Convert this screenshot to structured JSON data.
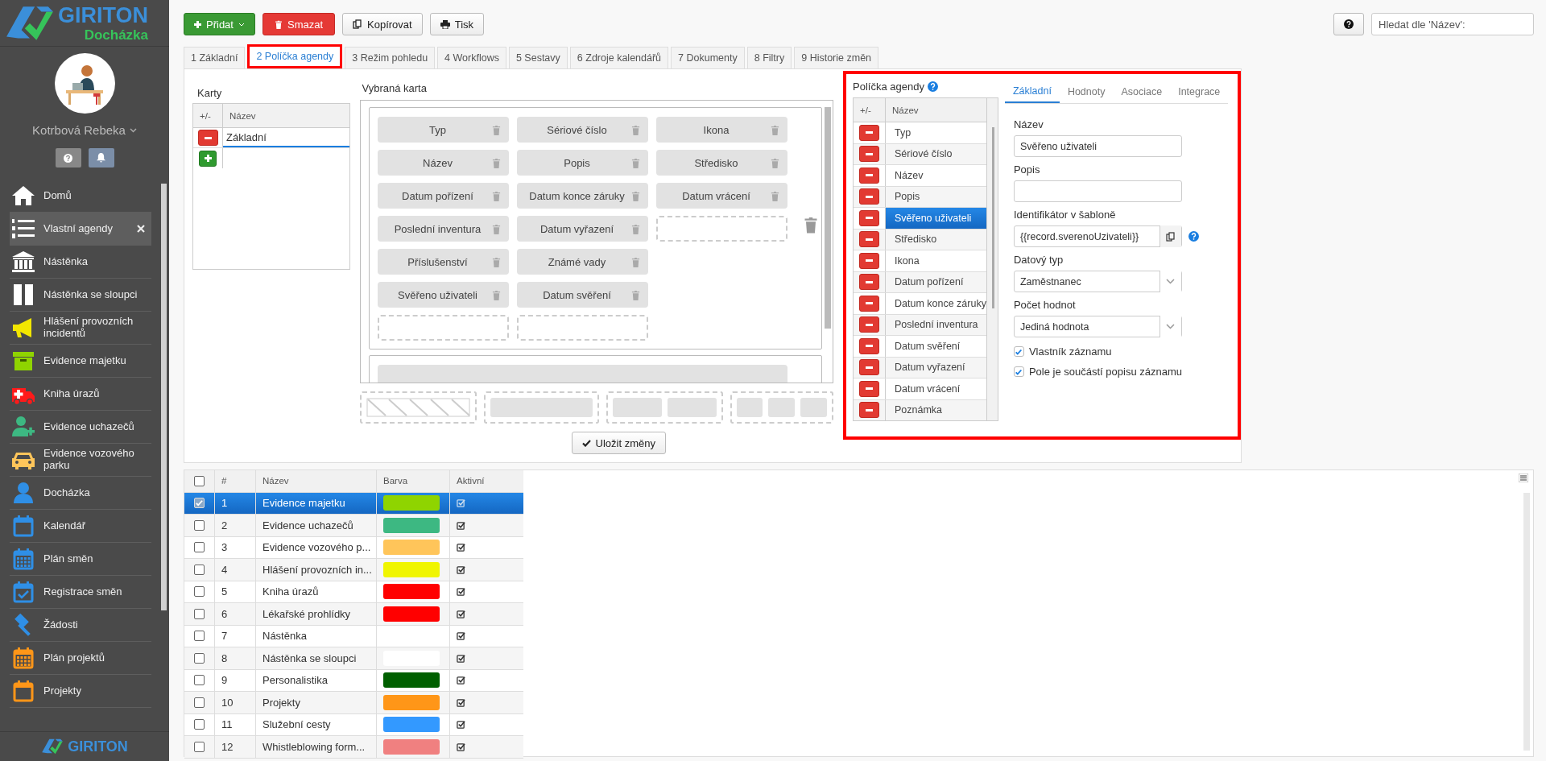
{
  "sidebar": {
    "logo": {
      "title": "GIRITON",
      "subtitle": "Docházka"
    },
    "user": {
      "name": "Kotrbová Rebeka"
    },
    "items": [
      {
        "label": "Domů",
        "kind": "home",
        "color": "#ffffff",
        "selected": false
      },
      {
        "label": "Vlastní agendy",
        "kind": "list",
        "color": "#ffffff",
        "selected": true
      },
      {
        "label": "Nástěnka",
        "kind": "bank",
        "color": "#ffffff",
        "selected": false
      },
      {
        "label": "Nástěnka se sloupci",
        "kind": "columns",
        "color": "#ffffff",
        "selected": false
      },
      {
        "label": "Hlášení provozních incidentů",
        "kind": "megaphone",
        "color": "#f2e600",
        "selected": false
      },
      {
        "label": "Evidence majetku",
        "kind": "box",
        "color": "#8fd400",
        "selected": false
      },
      {
        "label": "Kniha úrazů",
        "kind": "ambulance",
        "color": "#ff1a1a",
        "selected": false
      },
      {
        "label": "Evidence uchazečů",
        "kind": "user-plus",
        "color": "#3db882",
        "selected": false
      },
      {
        "label": "Evidence vozového parku",
        "kind": "car",
        "color": "#ffc55a",
        "selected": false
      },
      {
        "label": "Docházka",
        "kind": "user",
        "color": "#2f8fe6",
        "selected": false
      },
      {
        "label": "Kalendář",
        "kind": "calendar",
        "color": "#2f8fe6",
        "selected": false
      },
      {
        "label": "Plán směn",
        "kind": "calendar-grid",
        "color": "#2f8fe6",
        "selected": false
      },
      {
        "label": "Registrace směn",
        "kind": "calendar-check",
        "color": "#2f8fe6",
        "selected": false
      },
      {
        "label": "Žádosti",
        "kind": "gavel",
        "color": "#2f8fe6",
        "selected": false
      },
      {
        "label": "Plán projektů",
        "kind": "calendar-grid",
        "color": "#ff9618",
        "selected": false
      },
      {
        "label": "Projekty",
        "kind": "calendar",
        "color": "#ff9618",
        "selected": false
      }
    ],
    "footer_logo": "GIRITON"
  },
  "toolbar": {
    "buttons": [
      {
        "label": "Přidat",
        "kind": "add"
      },
      {
        "label": "Smazat",
        "kind": "delete"
      },
      {
        "label": "Kopírovat",
        "kind": "copy"
      },
      {
        "label": "Tisk",
        "kind": "print"
      }
    ],
    "search": {
      "placeholder": "Hledat dle 'Název':"
    }
  },
  "tabs": [
    {
      "label": "1 Základní",
      "selected": false,
      "highlighted": false
    },
    {
      "label": "2 Políčka agendy",
      "selected": true,
      "highlighted": true
    },
    {
      "label": "3 Režim pohledu",
      "selected": false,
      "highlighted": false
    },
    {
      "label": "4 Workflows",
      "selected": false,
      "highlighted": false
    },
    {
      "label": "5 Sestavy",
      "selected": false,
      "highlighted": false
    },
    {
      "label": "6 Zdroje kalendářů",
      "selected": false,
      "highlighted": false
    },
    {
      "label": "7 Dokumenty",
      "selected": false,
      "highlighted": false
    },
    {
      "label": "8 Filtry",
      "selected": false,
      "highlighted": false
    },
    {
      "label": "9 Historie změn",
      "selected": false,
      "highlighted": false
    }
  ],
  "cards_panel": {
    "title": "Karty",
    "columns": [
      "+/-",
      "Název"
    ],
    "rows": [
      {
        "name": "Základní",
        "selected": true
      }
    ]
  },
  "selected_card": {
    "title": "Vybraná karta",
    "cards": [
      {
        "rows": [
          [
            {
              "kind": "field",
              "label": "Typ"
            },
            {
              "kind": "field",
              "label": "Sériové číslo"
            },
            {
              "kind": "field",
              "label": "Ikona"
            }
          ],
          [
            {
              "kind": "field",
              "label": "Název"
            },
            {
              "kind": "field",
              "label": "Popis"
            },
            {
              "kind": "field",
              "label": "Středisko"
            }
          ],
          [
            {
              "kind": "field",
              "label": "Datum pořízení"
            },
            {
              "kind": "field",
              "label": "Datum konce záruky"
            },
            {
              "kind": "field",
              "label": "Datum vrácení"
            }
          ],
          [
            {
              "kind": "field",
              "label": "Poslední inventura"
            },
            {
              "kind": "field",
              "label": "Datum vyřazení"
            },
            {
              "kind": "slot"
            }
          ],
          [
            {
              "kind": "field",
              "label": "Příslušenství"
            },
            {
              "kind": "field",
              "label": "Známé vady"
            }
          ],
          [
            {
              "kind": "field",
              "label": "Svěřeno uživateli"
            },
            {
              "kind": "field",
              "label": "Datum svěření"
            }
          ],
          [
            {
              "kind": "slot"
            },
            {
              "kind": "slot"
            }
          ]
        ]
      },
      {
        "rows": [
          [
            {
              "kind": "wide"
            }
          ]
        ]
      }
    ],
    "layouts": [
      {
        "kind": "hatched"
      },
      {
        "kind": "one"
      },
      {
        "kind": "two"
      },
      {
        "kind": "three"
      }
    ],
    "save_button": "Uložit změny"
  },
  "agenda_fields": {
    "title": "Políčka agendy",
    "highlighted": true,
    "columns": [
      "+/-",
      "Název"
    ],
    "rows": [
      {
        "name": "Typ",
        "selected": false
      },
      {
        "name": "Sériové číslo",
        "selected": false
      },
      {
        "name": "Název",
        "selected": false
      },
      {
        "name": "Popis",
        "selected": false
      },
      {
        "name": "Svěřeno uživateli",
        "selected": true
      },
      {
        "name": "Středisko",
        "selected": false
      },
      {
        "name": "Ikona",
        "selected": false
      },
      {
        "name": "Datum pořízení",
        "selected": false
      },
      {
        "name": "Datum konce záruky",
        "selected": false
      },
      {
        "name": "Poslední inventura",
        "selected": false
      },
      {
        "name": "Datum svěření",
        "selected": false
      },
      {
        "name": "Datum vyřazení",
        "selected": false
      },
      {
        "name": "Datum vrácení",
        "selected": false
      },
      {
        "name": "Poznámka",
        "selected": false
      }
    ],
    "tabs": [
      {
        "label": "Základní",
        "selected": true
      },
      {
        "label": "Hodnoty",
        "selected": false
      },
      {
        "label": "Asociace",
        "selected": false
      },
      {
        "label": "Integrace",
        "selected": false
      }
    ],
    "form": [
      {
        "label": "Název",
        "kind": "text",
        "value": "Svěřeno uživateli"
      },
      {
        "label": "Popis",
        "kind": "text"
      },
      {
        "label": "Identifikátor v šabloně",
        "kind": "copy",
        "value": "{{record.sverenoUzivateli}}"
      },
      {
        "label": "Datový typ",
        "kind": "select",
        "value": "Zaměstnanec"
      },
      {
        "label": "Počet hodnot",
        "kind": "select",
        "value": "Jediná hodnota"
      }
    ],
    "checks": [
      {
        "label": "Vlastník záznamu",
        "checked": true
      },
      {
        "label": "Pole je součástí popisu záznamu",
        "checked": true
      }
    ]
  },
  "agenda_table": {
    "all_checked": false,
    "columns": [
      "#",
      "Název",
      "Barva",
      "Aktivní"
    ],
    "rows": [
      {
        "number": "1",
        "name": "Evidence majetku",
        "color": "#8fd400",
        "active": true,
        "selected": true
      },
      {
        "number": "2",
        "name": "Evidence uchazečů",
        "color": "#3db882",
        "active": true,
        "selected": false
      },
      {
        "number": "3",
        "name": "Evidence vozového p...",
        "color": "#ffc55a",
        "active": true,
        "selected": false
      },
      {
        "number": "4",
        "name": "Hlášení provozních in...",
        "color": "#f0f500",
        "active": true,
        "selected": false
      },
      {
        "number": "5",
        "name": "Kniha úrazů",
        "color": "#ff0000",
        "active": true,
        "selected": false
      },
      {
        "number": "6",
        "name": "Lékařské prohlídky",
        "color": "#ff0000",
        "active": true,
        "selected": false
      },
      {
        "number": "7",
        "name": "Nástěnka",
        "active": true,
        "selected": false
      },
      {
        "number": "8",
        "name": "Nástěnka se sloupci",
        "color": "#ffffff",
        "active": true,
        "selected": false
      },
      {
        "number": "9",
        "name": "Personalistika",
        "color": "#005f00",
        "active": true,
        "selected": false
      },
      {
        "number": "10",
        "name": "Projekty",
        "color": "#ff9618",
        "active": true,
        "selected": false
      },
      {
        "number": "11",
        "name": "Služební cesty",
        "color": "#3399ff",
        "active": true,
        "selected": false
      },
      {
        "number": "12",
        "name": "Whistleblowing form...",
        "color": "#f08080",
        "active": true,
        "selected": false
      }
    ]
  }
}
